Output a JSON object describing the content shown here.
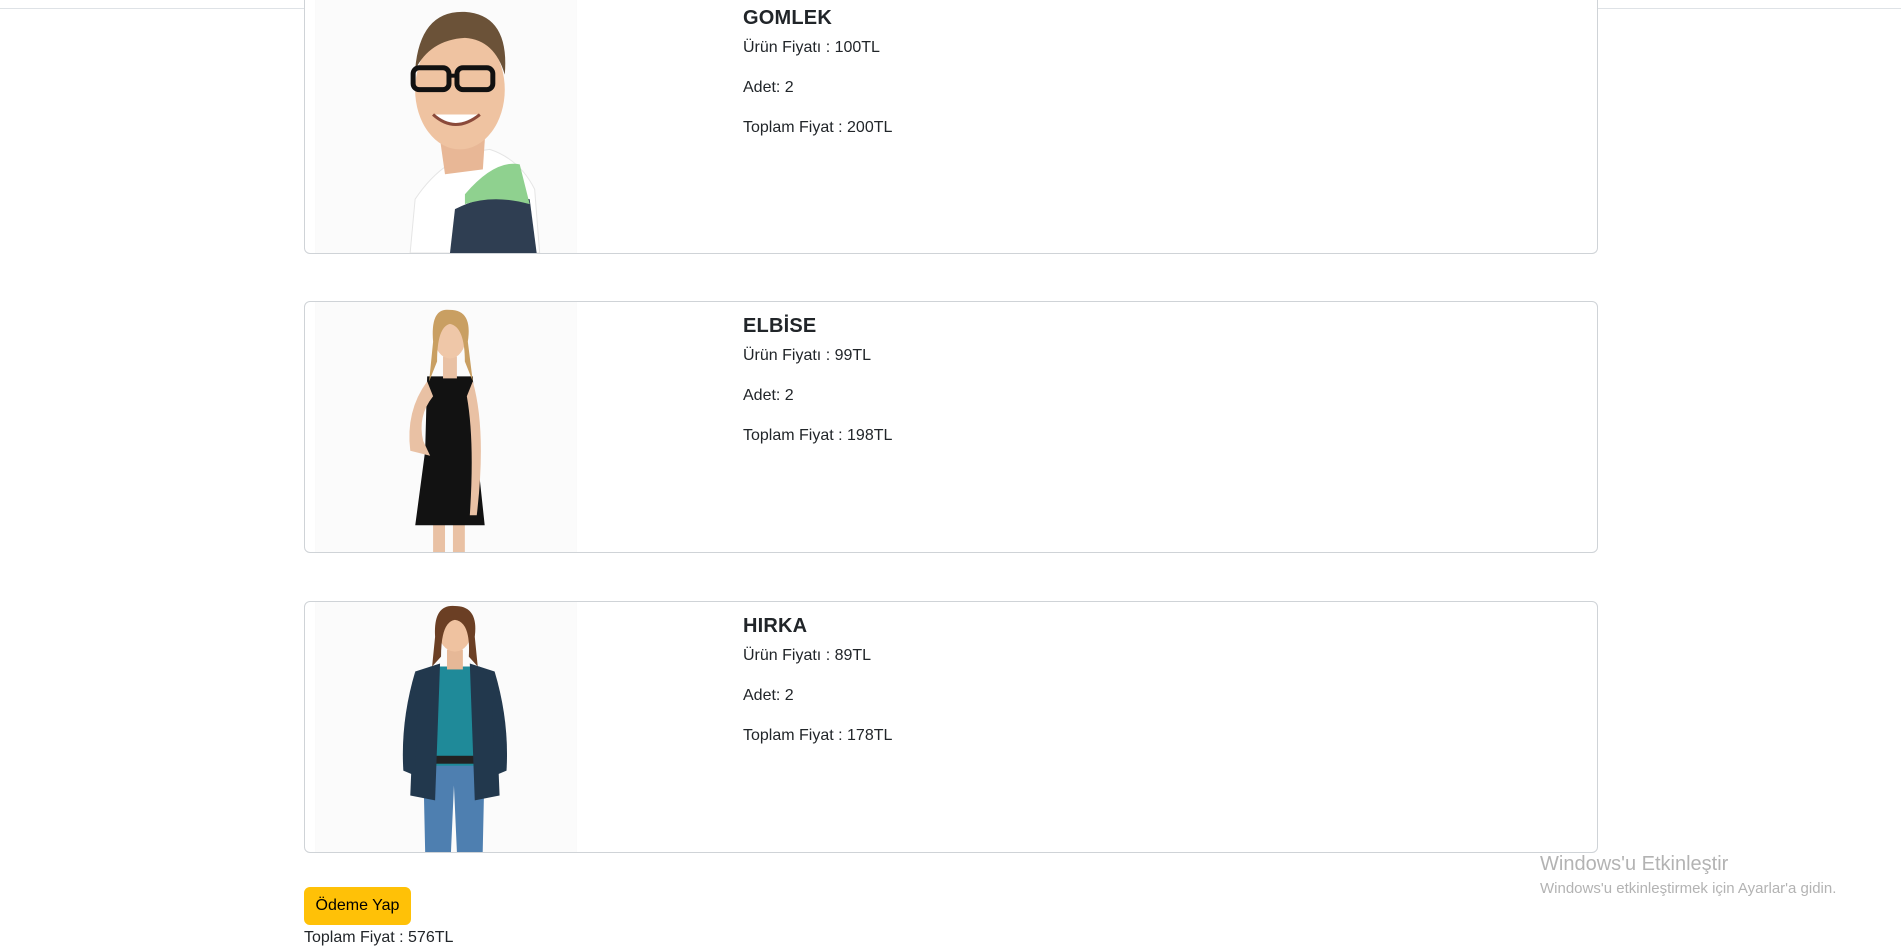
{
  "products": [
    {
      "name": "GOMLEK",
      "price_text": "Ürün Fiyatı : 100TL",
      "qty_text": "Adet: 2",
      "total_text": "Toplam Fiyat : 200TL"
    },
    {
      "name": "ELBİSE",
      "price_text": "Ürün Fiyatı : 99TL",
      "qty_text": "Adet: 2",
      "total_text": "Toplam Fiyat : 198TL"
    },
    {
      "name": "HIRKA",
      "price_text": "Ürün Fiyatı : 89TL",
      "qty_text": "Adet: 2",
      "total_text": "Toplam Fiyat : 178TL"
    }
  ],
  "checkout": {
    "button_label": "Ödeme Yap",
    "grand_total_text": "Toplam Fiyat : 576TL",
    "button_color": "#ffc107"
  },
  "windows_watermark": {
    "title": "Windows'u Etkinleştir",
    "subtitle": "Windows'u etkinleştirmek için Ayarlar'a gidin."
  }
}
